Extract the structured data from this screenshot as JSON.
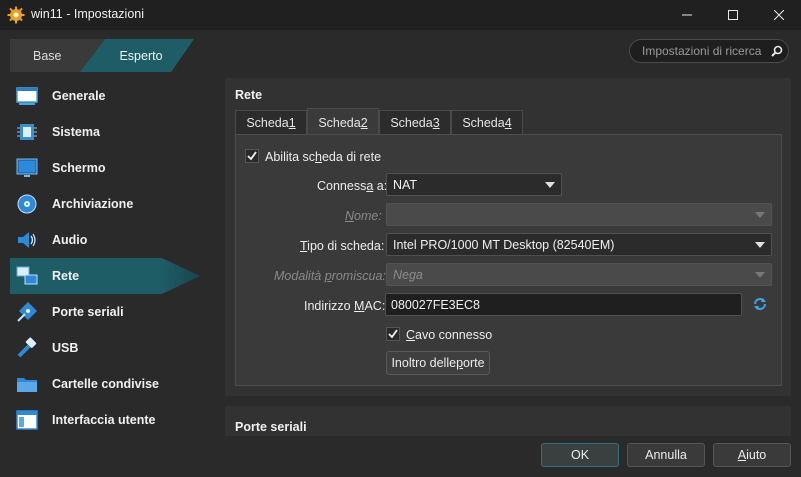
{
  "window": {
    "title": "win11 - Impostazioni",
    "controls": {
      "minimize": "minimize-icon",
      "maximize": "maximize-icon",
      "close": "close-icon"
    }
  },
  "mode": {
    "base_label": "Base",
    "expert_label": "Esperto",
    "selected": "Esperto"
  },
  "search": {
    "placeholder": "Impostazioni di ricerca"
  },
  "sidebar": {
    "items": [
      {
        "label": "Generale",
        "icon": "general-icon"
      },
      {
        "label": "Sistema",
        "icon": "system-icon"
      },
      {
        "label": "Schermo",
        "icon": "display-icon"
      },
      {
        "label": "Archiviazione",
        "icon": "storage-icon"
      },
      {
        "label": "Audio",
        "icon": "audio-icon"
      },
      {
        "label": "Rete",
        "icon": "network-icon"
      },
      {
        "label": "Porte seriali",
        "icon": "serial-ports-icon"
      },
      {
        "label": "USB",
        "icon": "usb-icon"
      },
      {
        "label": "Cartelle condivise",
        "icon": "shared-folders-icon"
      },
      {
        "label": "Interfaccia utente",
        "icon": "user-interface-icon"
      }
    ],
    "active": "Rete"
  },
  "network": {
    "title": "Rete",
    "tabs": [
      {
        "prefix": "Scheda ",
        "key": "1"
      },
      {
        "prefix": "Scheda ",
        "key": "2"
      },
      {
        "prefix": "Scheda ",
        "key": "3"
      },
      {
        "prefix": "Scheda ",
        "key": "4"
      }
    ],
    "active_tab": "Scheda 2",
    "enable_label_pre": "Abilita sc",
    "enable_label_key": "h",
    "enable_label_post": "eda di rete",
    "enable_checked": true,
    "attached_label_pre": "Conness",
    "attached_label_key": "a",
    "attached_label_post": " a:",
    "attached_value": "NAT",
    "name_label_pre": "",
    "name_label_key": "N",
    "name_label_post": "ome:",
    "name_value": "",
    "type_label_pre": "",
    "type_label_key": "T",
    "type_label_post": "ipo di scheda:",
    "type_value": "Intel PRO/1000 MT Desktop (82540EM)",
    "promisc_label_pre": "Modalità ",
    "promisc_label_key": "p",
    "promisc_label_post": "romiscua:",
    "promisc_value": "Nega",
    "mac_label_pre": "Indirizzo ",
    "mac_label_key": "M",
    "mac_label_post": "AC:",
    "mac_value": "080027FE3EC8",
    "cable_label_pre": "",
    "cable_label_key": "C",
    "cable_label_post": "avo connesso",
    "cable_checked": true,
    "port_forward_pre": "Inoltro delle ",
    "port_forward_key": "p",
    "port_forward_post": "orte"
  },
  "serial_group": {
    "title": "Porte seriali"
  },
  "footer": {
    "ok": "OK",
    "cancel": "Annulla",
    "help_key": "A",
    "help_rest": "iuto"
  },
  "colors": {
    "accent": "#1e5c66",
    "background": "#2a2a2a",
    "panel": "#323232",
    "refresh_icon": "#3da4e8"
  }
}
